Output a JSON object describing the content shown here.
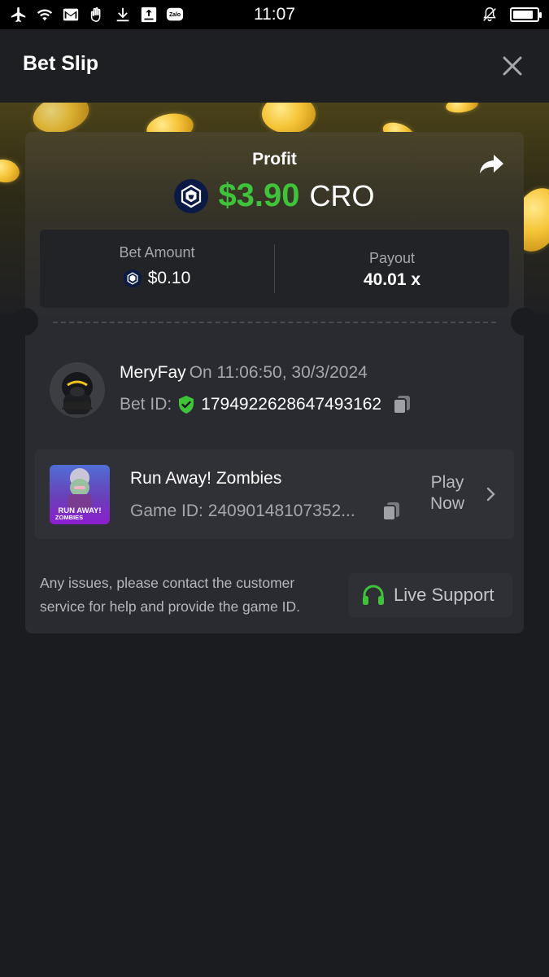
{
  "status_bar": {
    "time": "11:07",
    "left_icons": [
      "airplane-icon",
      "wifi-icon",
      "gmail-icon",
      "hand-icon",
      "download-icon",
      "upload-app-icon",
      "zalo-icon"
    ],
    "zalo_text": "Zalo",
    "battery_level": 0.85
  },
  "header": {
    "title": "Bet Slip"
  },
  "result": {
    "profit_label": "Profit",
    "profit_amount": "$3.90",
    "currency": "CRO",
    "profit_color": "#3fc33a"
  },
  "stats": {
    "bet_amount_label": "Bet Amount",
    "bet_amount_value": "$0.10",
    "payout_label": "Payout",
    "payout_value": "40.01 x"
  },
  "user": {
    "name": "MeryFay",
    "timestamp": "On 11:06:50, 30/3/2024",
    "bet_id_label": "Bet ID:",
    "bet_id": "1794922628647493162"
  },
  "game": {
    "title": "Run Away! Zombies",
    "game_id_text": "Game ID: 24090148107352...",
    "thumb_text_line1": "RUN AWAY!",
    "thumb_text_line2": "ZOMBIES",
    "play_label_line1": "Play",
    "play_label_line2": "Now"
  },
  "footer": {
    "help_text": "Any issues, please contact the customer service for help and provide the game ID.",
    "live_support_label": "Live Support",
    "support_icon_color": "#3fc33a"
  }
}
